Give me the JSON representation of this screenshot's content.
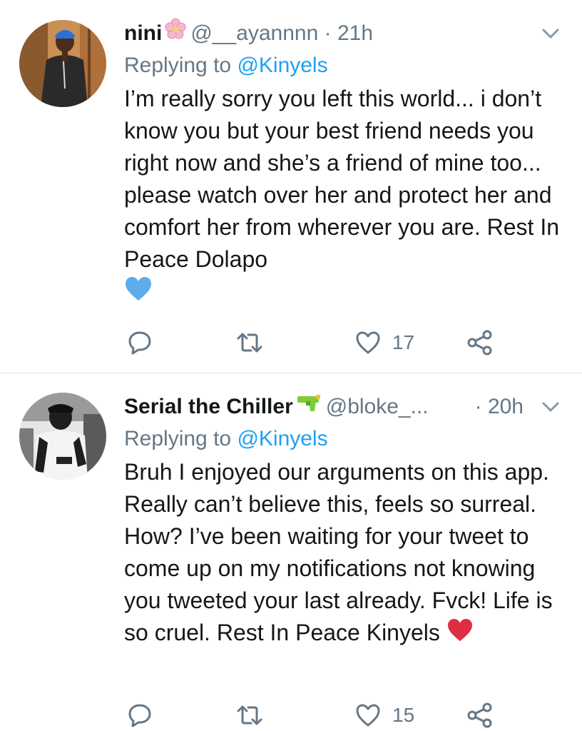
{
  "colors": {
    "text": "#14171a",
    "muted": "#657786",
    "link": "#1da1f2",
    "divider": "#e1e8ed",
    "blue_heart": "#5dadec",
    "red_heart": "#dd2e44"
  },
  "tweets": [
    {
      "display_name": "nini",
      "name_emoji": "cherry-blossom-icon",
      "handle": "@__ayannnn",
      "separator": "·",
      "time": "21h",
      "replying_label": "Replying to",
      "replying_to": "@Kinyels",
      "text": "I’m really sorry you left this world... i don’t know you but your best friend needs you right now and she’s a friend of mine too... please watch over her and protect her and comfort her from wherever you are. Rest In Peace Dolapo",
      "text_emoji": "blue-heart-icon",
      "actions": {
        "reply_count": "",
        "retweet_count": "",
        "like_count": "17"
      }
    },
    {
      "display_name": "Serial the Chiller",
      "name_emoji": "water-pistol-icon",
      "handle": "@bloke_...",
      "separator": "·",
      "time": "20h",
      "replying_label": "Replying to",
      "replying_to": "@Kinyels",
      "text": "Bruh I enjoyed our arguments on this app. Really can’t believe this, feels so surreal. How? I’ve been waiting for your tweet to come up on my notifications not knowing you tweeted your last already. Fvck! Life is so cruel. Rest In Peace Kinyels",
      "text_emoji": "red-heart-icon",
      "actions": {
        "reply_count": "",
        "retweet_count": "",
        "like_count": "15"
      }
    }
  ]
}
